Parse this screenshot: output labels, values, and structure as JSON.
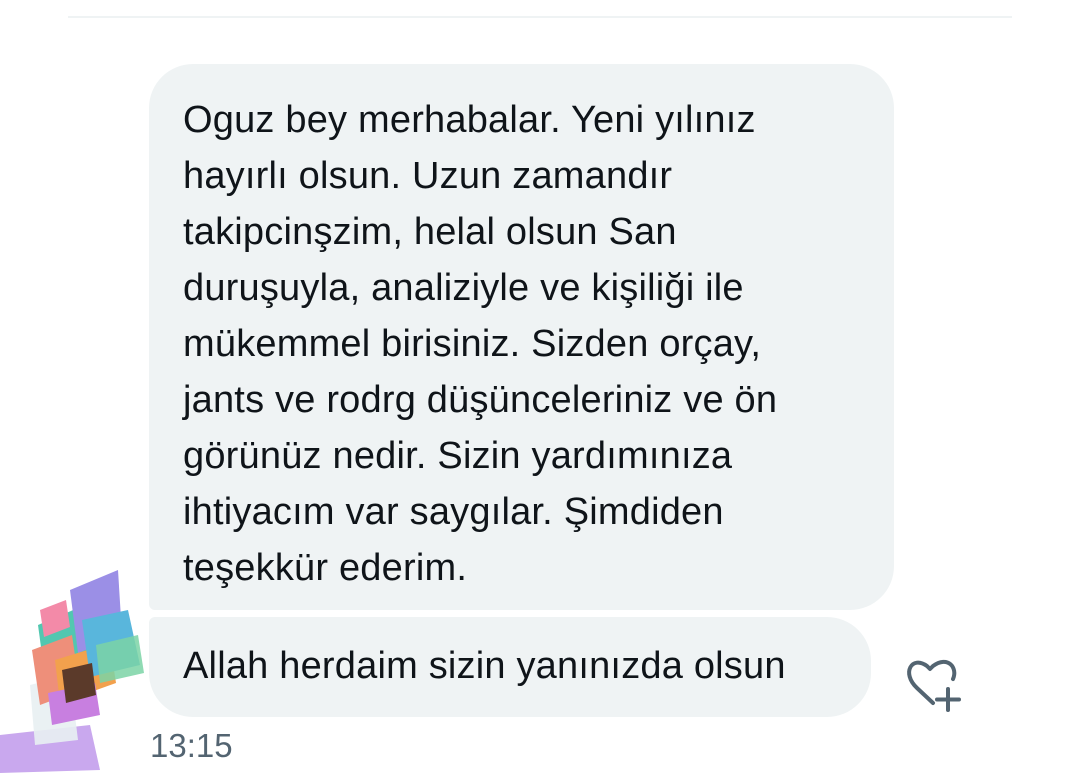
{
  "conversation": {
    "messages": [
      {
        "text": "Oguz bey merhabalar. Yeni yılınız\nhayırlı olsun. Uzun zamandır\ntakipcinşzim, helal olsun San\nduruşuyla, analiziyle ve kişiliği ile\nmükemmel birisiniz. Sizden orçay,\njants ve rodrg düşünceleriniz ve ön\ngörünüz nedir. Sizin yardımınıza\nihtiyacım var saygılar. Şimdiden\nteşekkür ederim."
      },
      {
        "text": "Allah herdaim sizin yanınızda olsun"
      }
    ],
    "timestamp": "13:15",
    "react_icon": "heart-plus-icon",
    "avatar_icon": "abstract-avatar-image"
  },
  "colors": {
    "bubble_background": "#eff3f4",
    "message_text": "#0f1419",
    "timestamp_text": "#536471",
    "divider": "#eff3f4",
    "icon_stroke": "#536471"
  }
}
